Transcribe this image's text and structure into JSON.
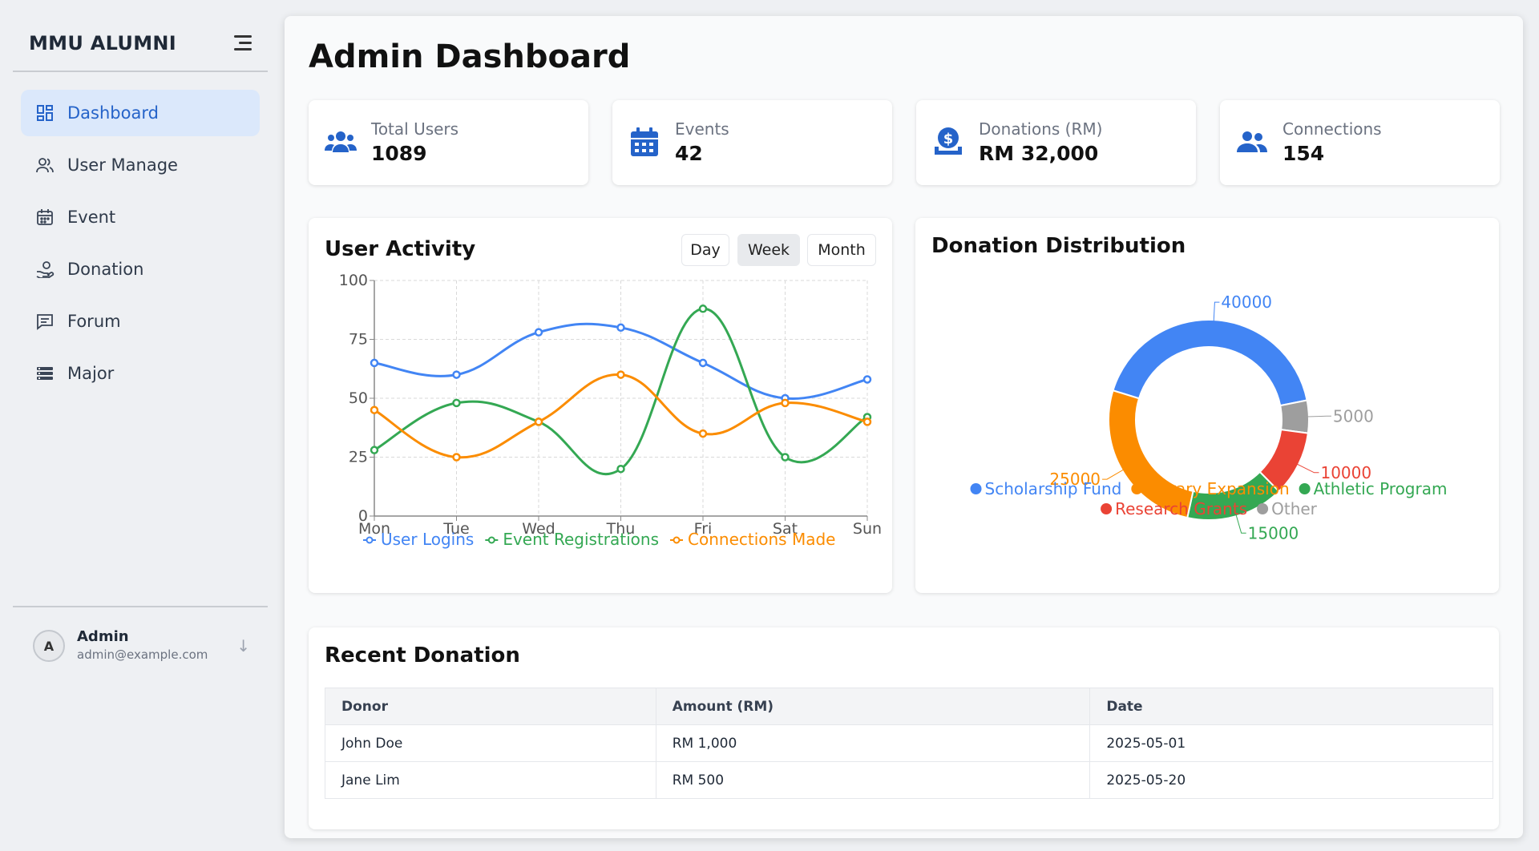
{
  "sidebar": {
    "brand": "MMU ALUMNI",
    "items": [
      {
        "label": "Dashboard",
        "icon": "dashboard-icon",
        "active": true
      },
      {
        "label": "User Manage",
        "icon": "users-icon"
      },
      {
        "label": "Event",
        "icon": "calendar-icon"
      },
      {
        "label": "Donation",
        "icon": "hand-coin-icon"
      },
      {
        "label": "Forum",
        "icon": "chat-icon"
      },
      {
        "label": "Major",
        "icon": "list-icon"
      }
    ],
    "user": {
      "initial": "A",
      "name": "Admin",
      "email": "admin@example.com"
    }
  },
  "page": {
    "title": "Admin Dashboard"
  },
  "stats": [
    {
      "label": "Total Users",
      "value": "1089",
      "icon": "users-icon"
    },
    {
      "label": "Events",
      "value": "42",
      "icon": "calendar-icon"
    },
    {
      "label": "Donations (RM)",
      "value": "RM 32,000",
      "icon": "dollar-box-icon"
    },
    {
      "label": "Connections",
      "value": "154",
      "icon": "people-icon"
    }
  ],
  "activity": {
    "title": "User Activity",
    "ranges": [
      "Day",
      "Week",
      "Month"
    ],
    "active_range": "Week"
  },
  "distribution": {
    "title": "Donation Distribution"
  },
  "recent": {
    "title": "Recent Donation",
    "columns": [
      "Donor",
      "Amount (RM)",
      "Date"
    ],
    "rows": [
      [
        "John Doe",
        "RM 1,000",
        "2025-05-01"
      ],
      [
        "Jane Lim",
        "RM 500",
        "2025-05-20"
      ]
    ]
  },
  "colors": {
    "accent": "#2563c9",
    "blue": "#4285f4",
    "green": "#34a853",
    "orange": "#fb8c00",
    "red": "#ea4335",
    "gray": "#9e9e9e"
  },
  "chart_data": [
    {
      "type": "line",
      "title": "User Activity",
      "categories": [
        "Mon",
        "Tue",
        "Wed",
        "Thu",
        "Fri",
        "Sat",
        "Sun"
      ],
      "series": [
        {
          "name": "User Logins",
          "color": "#4285f4",
          "values": [
            65,
            60,
            78,
            80,
            65,
            50,
            58
          ]
        },
        {
          "name": "Event Registrations",
          "color": "#34a853",
          "values": [
            28,
            48,
            40,
            20,
            88,
            25,
            42
          ]
        },
        {
          "name": "Connections Made",
          "color": "#fb8c00",
          "values": [
            45,
            25,
            40,
            60,
            35,
            48,
            40
          ]
        }
      ],
      "ylim": [
        0,
        100
      ],
      "yticks": [
        0,
        25,
        50,
        75,
        100
      ],
      "grid": true,
      "legend": "bottom"
    },
    {
      "type": "pie",
      "title": "Donation Distribution",
      "donut": true,
      "slices": [
        {
          "name": "Scholarship Fund",
          "value": 40000,
          "color": "#4285f4"
        },
        {
          "name": "Other",
          "value": 5000,
          "color": "#9e9e9e"
        },
        {
          "name": "Research Grants",
          "value": 10000,
          "color": "#ea4335"
        },
        {
          "name": "Athletic Program",
          "value": 15000,
          "color": "#34a853"
        },
        {
          "name": "Library Expansion",
          "value": 25000,
          "color": "#fb8c00"
        }
      ],
      "legend_order": [
        "Scholarship Fund",
        "Library Expansion",
        "Athletic Program",
        "Research Grants",
        "Other"
      ],
      "legend": "bottom"
    }
  ]
}
